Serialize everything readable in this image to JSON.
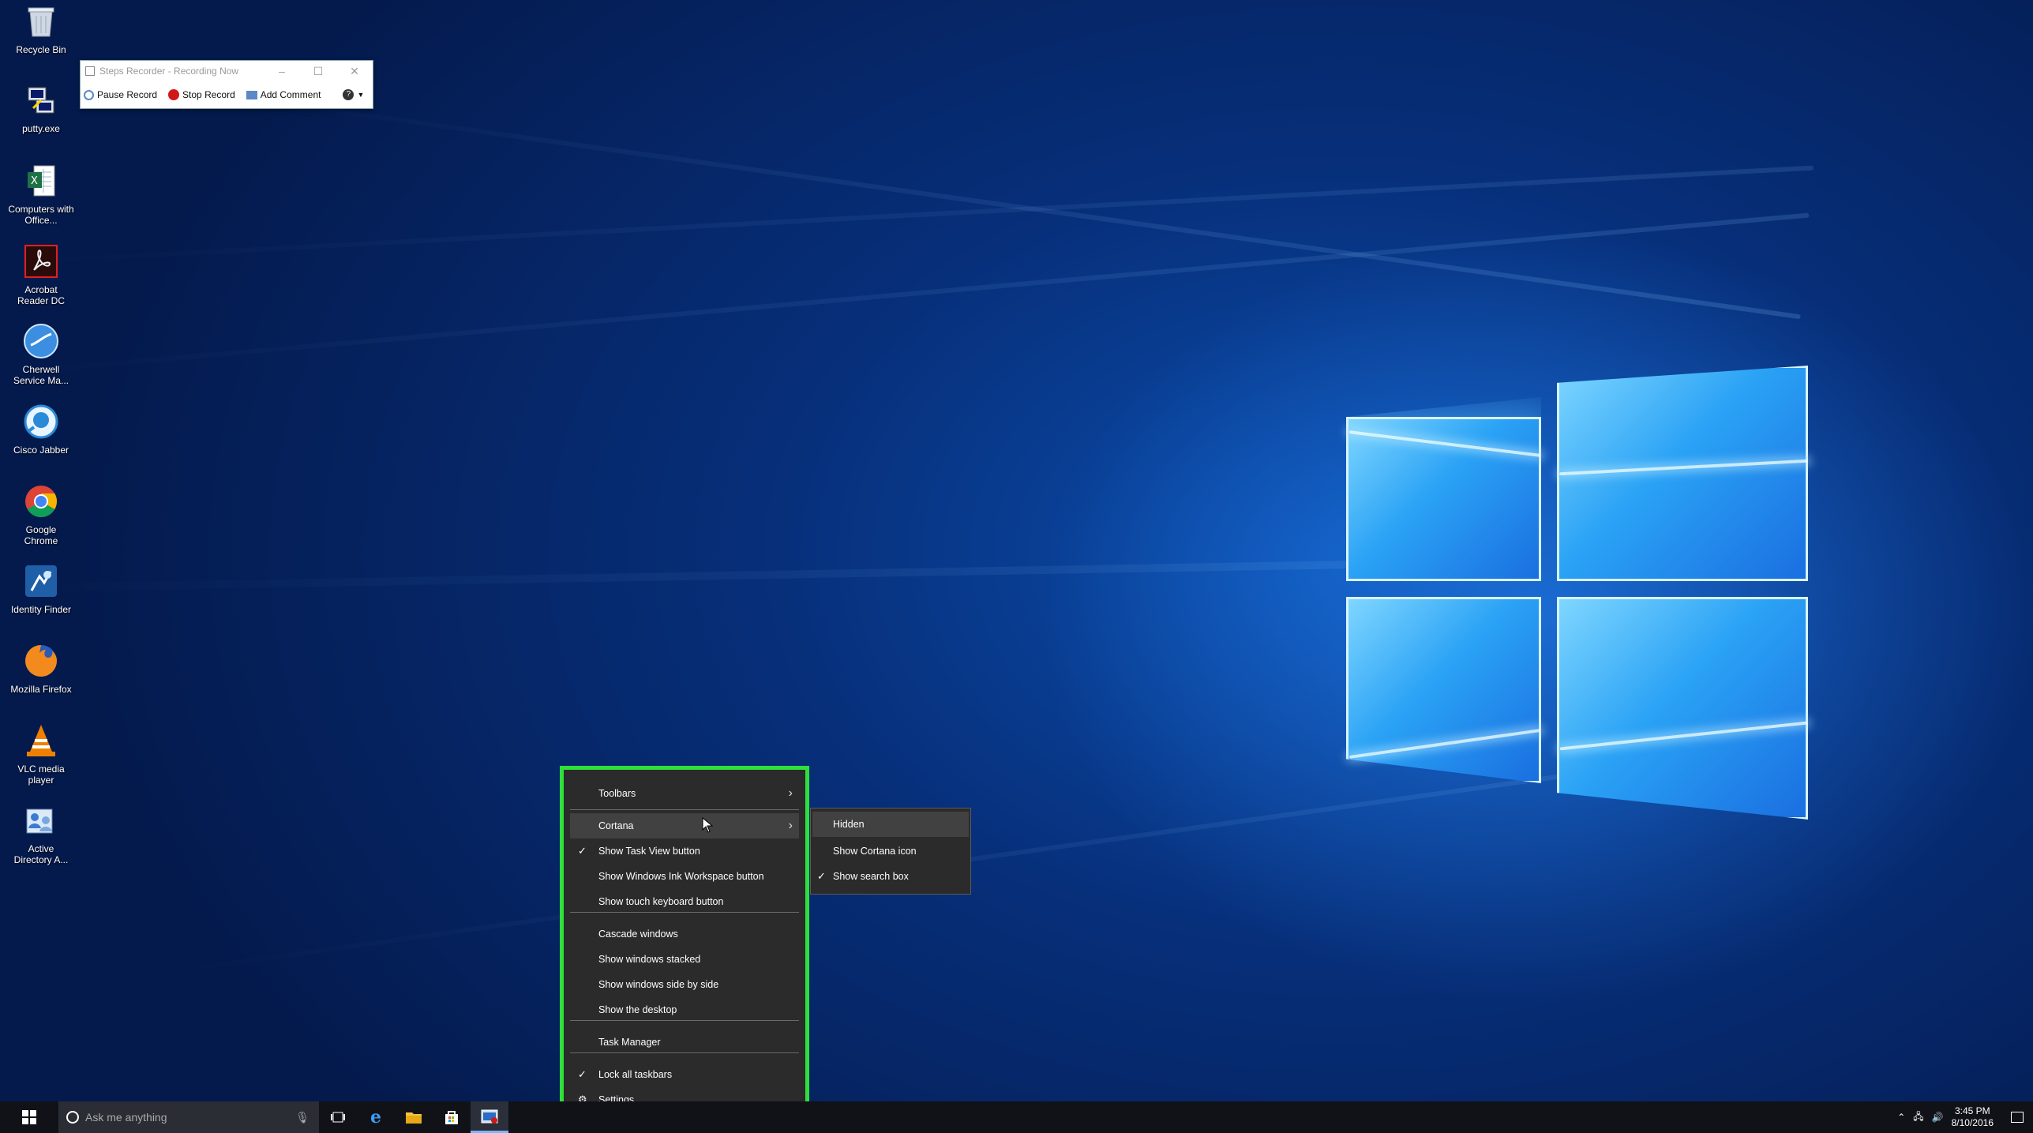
{
  "desktop_icons": [
    {
      "label": "Recycle Bin",
      "icon": "recycle-bin-icon"
    },
    {
      "label": "putty.exe",
      "icon": "putty-icon"
    },
    {
      "label": "Computers with Office...",
      "icon": "excel-icon"
    },
    {
      "label": "Acrobat Reader DC",
      "icon": "acrobat-icon"
    },
    {
      "label": "Cherwell Service Ma...",
      "icon": "cherwell-icon"
    },
    {
      "label": "Cisco Jabber",
      "icon": "jabber-icon"
    },
    {
      "label": "Google Chrome",
      "icon": "chrome-icon"
    },
    {
      "label": "Identity Finder",
      "icon": "identity-finder-icon"
    },
    {
      "label": "Mozilla Firefox",
      "icon": "firefox-icon"
    },
    {
      "label": "VLC media player",
      "icon": "vlc-icon"
    },
    {
      "label": "Active Directory A...",
      "icon": "active-directory-icon"
    }
  ],
  "steps_recorder": {
    "title": "Steps Recorder - Recording Now",
    "pause": "Pause Record",
    "stop": "Stop Record",
    "comment": "Add Comment"
  },
  "context_menu": {
    "items": {
      "toolbars": "Toolbars",
      "cortana": "Cortana",
      "task_view": "Show Task View button",
      "ink": "Show Windows Ink Workspace button",
      "touch_kb": "Show touch keyboard button",
      "cascade": "Cascade windows",
      "stacked": "Show windows stacked",
      "side_by_side": "Show windows side by side",
      "show_desktop": "Show the desktop",
      "task_manager": "Task Manager",
      "lock": "Lock all taskbars",
      "settings": "Settings"
    },
    "highlight_color": "#2fe03a"
  },
  "cortana_submenu": {
    "hidden": "Hidden",
    "icon": "Show Cortana icon",
    "search_box": "Show search box"
  },
  "taskbar": {
    "search_placeholder": "Ask me anything",
    "time": "3:45 PM",
    "date": "8/10/2016"
  }
}
